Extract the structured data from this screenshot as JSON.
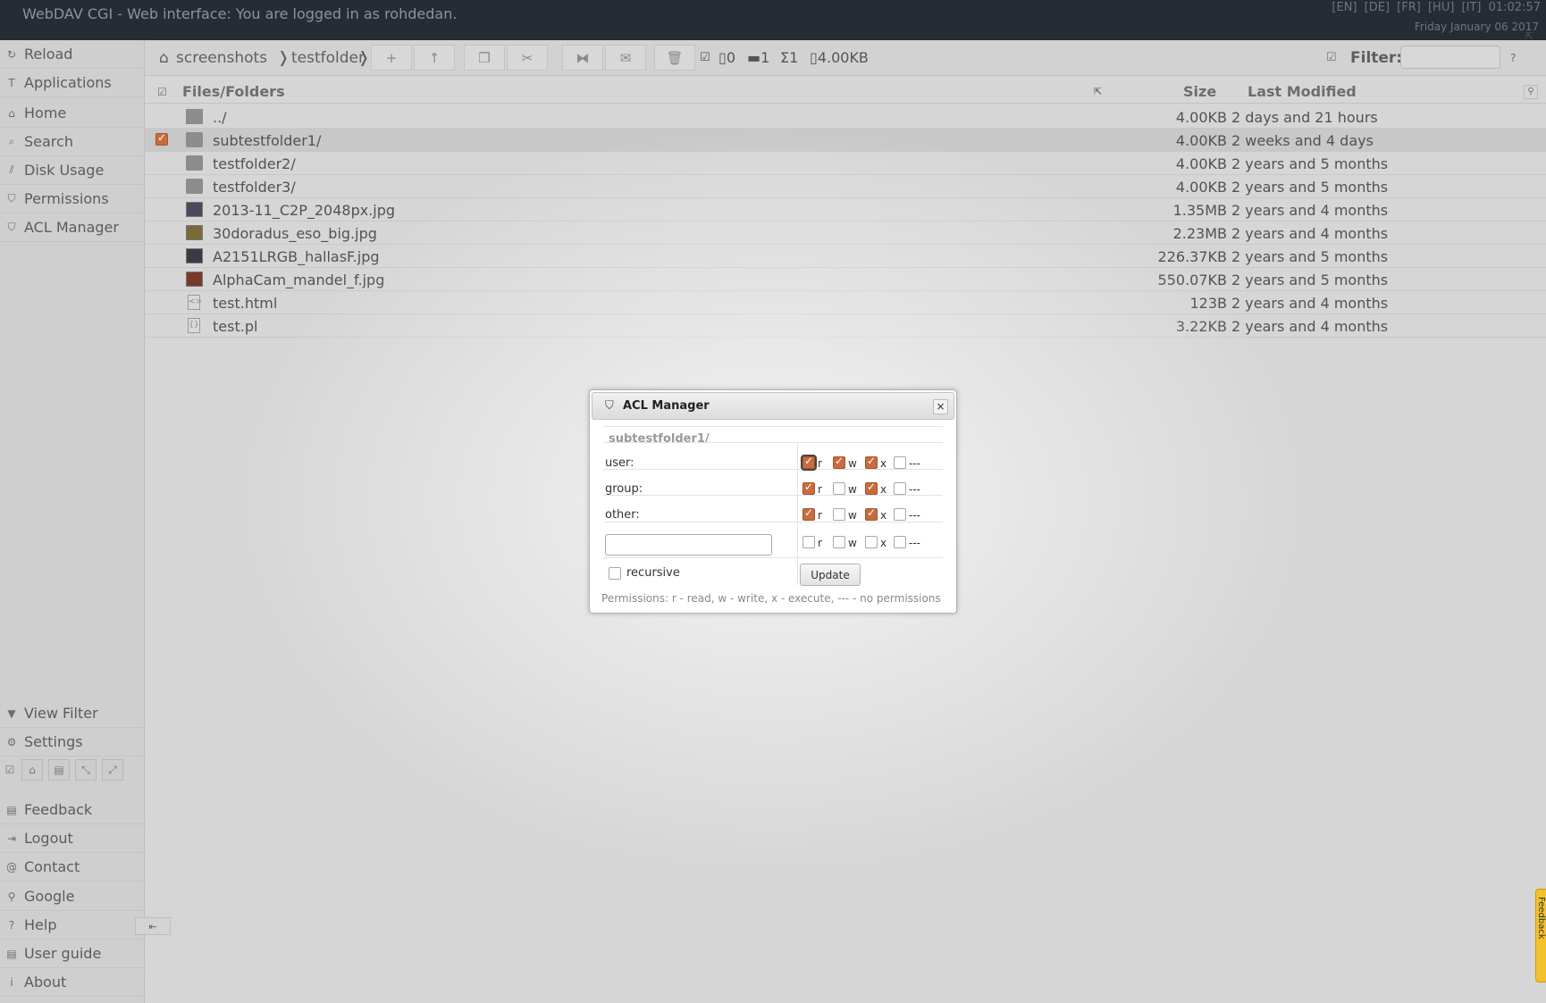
{
  "header": {
    "title": "WebDAV CGI - Web interface: You are logged in as rohdedan.",
    "languages": [
      "[EN]",
      "[DE]",
      "[FR]",
      "[HU]",
      "[IT]"
    ],
    "time": "01:02:57",
    "date": "Friday January 06 2017",
    "corner_glyph": "⇱"
  },
  "sidebar": {
    "items": [
      {
        "label": "Reload",
        "icon": "reload-icon",
        "glyph": "↻"
      },
      {
        "label": "Applications",
        "icon": "applications-icon",
        "glyph": "T"
      },
      {
        "label": "Home",
        "icon": "home-icon",
        "glyph": "⌂"
      },
      {
        "label": "Search",
        "icon": "search-icon",
        "glyph": "⌕"
      },
      {
        "label": "Disk Usage",
        "icon": "chart-icon",
        "glyph": "⫽"
      },
      {
        "label": "Permissions",
        "icon": "shield-icon",
        "glyph": "⛉"
      },
      {
        "label": "ACL Manager",
        "icon": "shield-icon",
        "glyph": "⛉"
      }
    ],
    "bottom_items": [
      {
        "label": "View Filter",
        "icon": "filter-icon",
        "glyph": "▼"
      },
      {
        "label": "Settings",
        "icon": "gear-icon",
        "glyph": "⚙"
      },
      {
        "label": "Feedback",
        "icon": "comment-icon",
        "glyph": "▤"
      },
      {
        "label": "Logout",
        "icon": "logout-icon",
        "glyph": "⇥"
      },
      {
        "label": "Contact",
        "icon": "at-icon",
        "glyph": "@"
      },
      {
        "label": "Google",
        "icon": "link-icon",
        "glyph": "⚲"
      },
      {
        "label": "Help",
        "icon": "help-icon",
        "glyph": "?"
      },
      {
        "label": "User guide",
        "icon": "book-icon",
        "glyph": "▤"
      },
      {
        "label": "About",
        "icon": "info-icon",
        "glyph": "i"
      }
    ],
    "tools": [
      "☑",
      "⌂",
      "▤",
      "⤡",
      "⤢"
    ],
    "collapse_glyph": "⇤"
  },
  "toolbar": {
    "home_glyph": "⌂",
    "breadcrumbs": [
      "screenshots",
      "testfolder"
    ],
    "sep": "❭",
    "buttons": [
      {
        "name": "new-button",
        "glyph": "+"
      },
      {
        "name": "upload-button",
        "glyph": "↑"
      },
      {
        "name": "copy-button",
        "glyph": "❐"
      },
      {
        "name": "cut-button",
        "glyph": "✂"
      },
      {
        "name": "rename-button",
        "glyph": "⧓"
      },
      {
        "name": "mail-button",
        "glyph": "✉"
      },
      {
        "name": "delete-button",
        "glyph": "🗑"
      }
    ],
    "stats": {
      "selected_glyph": "☑",
      "files": "0",
      "folders": "1",
      "sum": "1",
      "size": "4.00KB"
    },
    "filter_label": "Filter:",
    "filter_value": "",
    "filter_help": "?"
  },
  "table": {
    "columns": {
      "name": "Files/Folders",
      "size": "Size",
      "modified": "Last Modified"
    },
    "rows": [
      {
        "name": "../",
        "size": "4.00KB",
        "modified": "2 days and 21 hours",
        "type": "up",
        "selected": false
      },
      {
        "name": "subtestfolder1/",
        "size": "4.00KB",
        "modified": "2 weeks and 4 days",
        "type": "folder",
        "selected": true
      },
      {
        "name": "testfolder2/",
        "size": "4.00KB",
        "modified": "2 years and 5 months",
        "type": "folder",
        "selected": false
      },
      {
        "name": "testfolder3/",
        "size": "4.00KB",
        "modified": "2 years and 5 months",
        "type": "folder",
        "selected": false
      },
      {
        "name": "2013-11_C2P_2048px.jpg",
        "size": "1.35MB",
        "modified": "2 years and 4 months",
        "type": "img",
        "color": "#4a4a5a",
        "selected": false
      },
      {
        "name": "30doradus_eso_big.jpg",
        "size": "2.23MB",
        "modified": "2 years and 4 months",
        "type": "img",
        "color": "#7a6a3a",
        "selected": false
      },
      {
        "name": "A2151LRGB_hallasF.jpg",
        "size": "226.37KB",
        "modified": "2 years and 5 months",
        "type": "img",
        "color": "#3a3a46",
        "selected": false
      },
      {
        "name": "AlphaCam_mandel_f.jpg",
        "size": "550.07KB",
        "modified": "2 years and 5 months",
        "type": "img",
        "color": "#7a3a2a",
        "selected": false
      },
      {
        "name": "test.html",
        "size": "123B",
        "modified": "2 years and 4 months",
        "type": "code",
        "glyph": "<>",
        "selected": false
      },
      {
        "name": "test.pl",
        "size": "3.22KB",
        "modified": "2 years and 4 months",
        "type": "code",
        "glyph": "{}",
        "selected": false
      }
    ]
  },
  "dialog": {
    "title": "ACL Manager",
    "close": "×",
    "path": "subtestfolder1/",
    "rows": [
      {
        "label": "user:",
        "r": true,
        "w": true,
        "x": true,
        "none": false,
        "focus": true
      },
      {
        "label": "group:",
        "r": true,
        "w": false,
        "x": true,
        "none": false
      },
      {
        "label": "other:",
        "r": true,
        "w": false,
        "x": true,
        "none": false
      },
      {
        "label": "",
        "r": false,
        "w": false,
        "x": false,
        "none": false,
        "input": true
      }
    ],
    "perm_labels": {
      "r": "r",
      "w": "w",
      "x": "x",
      "none": "---"
    },
    "recursive_label": "recursive",
    "update_label": "Update",
    "help": "Permissions: r - read, w - write, x - execute, --- - no permissions"
  },
  "feedback_tab": "Feedback",
  "colors": {
    "accent": "#c96b3c",
    "header": "#262c33"
  }
}
